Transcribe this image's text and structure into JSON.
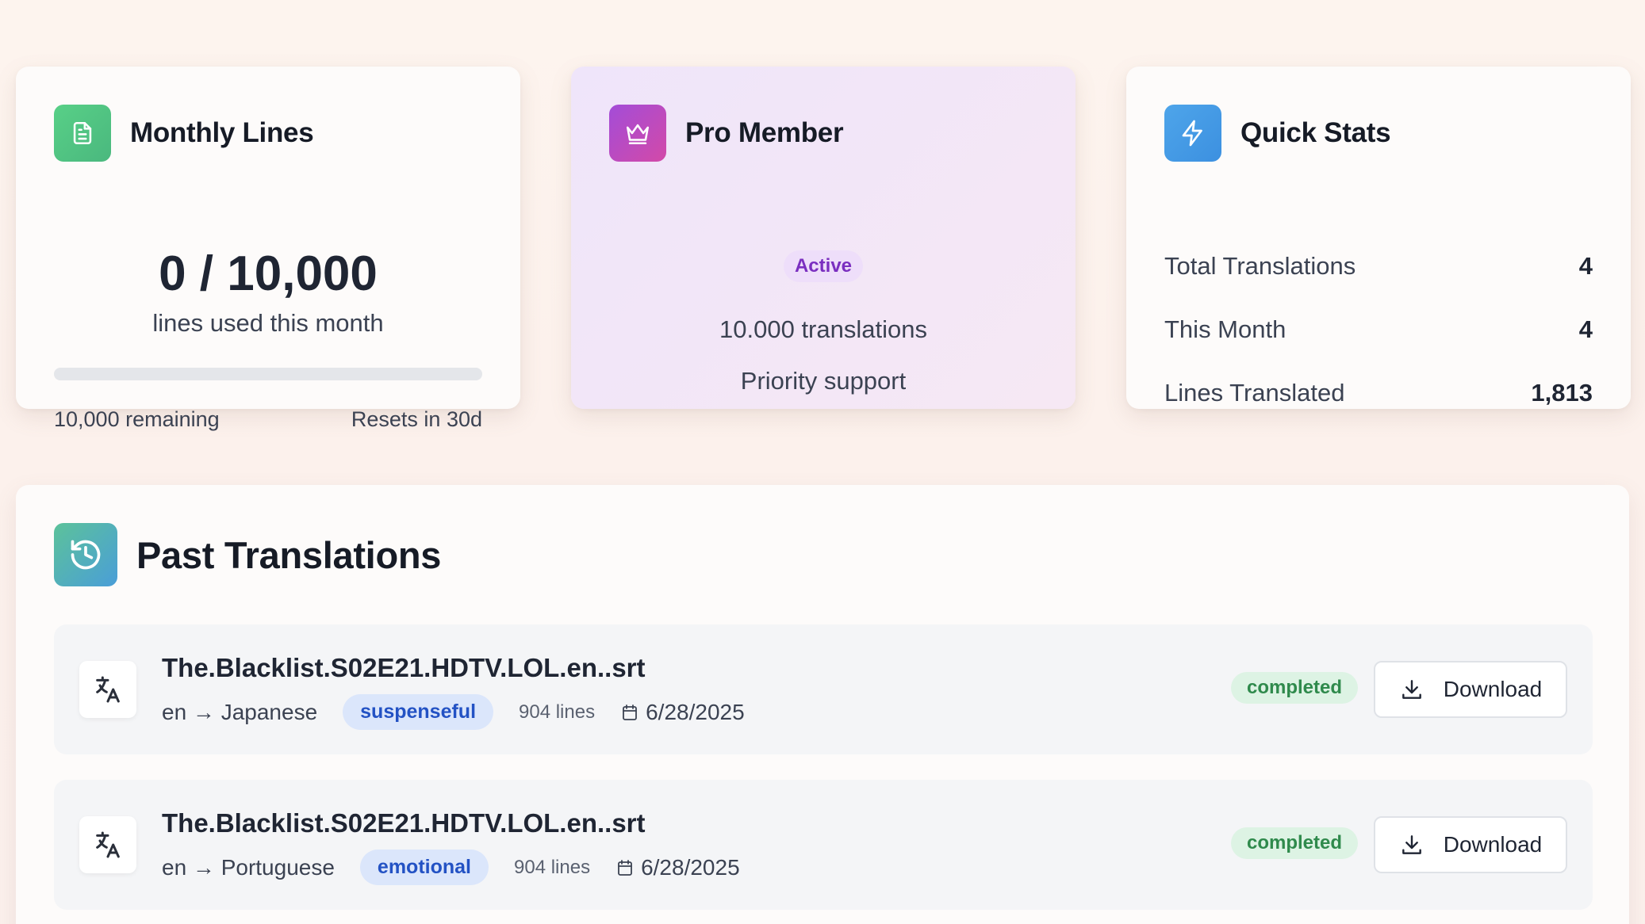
{
  "usage_card": {
    "title": "Monthly Lines",
    "icon": "document-icon",
    "usage_text": "0 / 10,000",
    "usage_sub": "lines used this month",
    "progress_fraction": 0.0,
    "remaining": "10,000 remaining",
    "resets": "Resets in 30d",
    "accent": "#4ab87e"
  },
  "membership_card": {
    "title": "Pro Member",
    "icon": "crown-icon",
    "status": "Active",
    "features": [
      "10.000 translations",
      "Priority support"
    ],
    "accent": "#a34cd8"
  },
  "stats_card": {
    "title": "Quick Stats",
    "icon": "lightning-icon",
    "rows": [
      {
        "label": "Total Translations",
        "value": "4"
      },
      {
        "label": "This Month",
        "value": "4"
      },
      {
        "label": "Lines Translated",
        "value": "1,813"
      }
    ]
  },
  "history": {
    "title": "Past Translations",
    "icon": "history-icon",
    "items": [
      {
        "file": "The.Blacklist.S02E21.HDTV.LOL.en..srt",
        "lang": "en → Japanese",
        "tone": "suspenseful",
        "lines": "904 lines",
        "date": "6/28/2025",
        "status": "completed",
        "download": "Download"
      },
      {
        "file": "The.Blacklist.S02E21.HDTV.LOL.en..srt",
        "lang": "en → Portuguese",
        "tone": "emotional",
        "lines": "904 lines",
        "date": "6/28/2025",
        "status": "completed",
        "download": "Download"
      }
    ]
  }
}
